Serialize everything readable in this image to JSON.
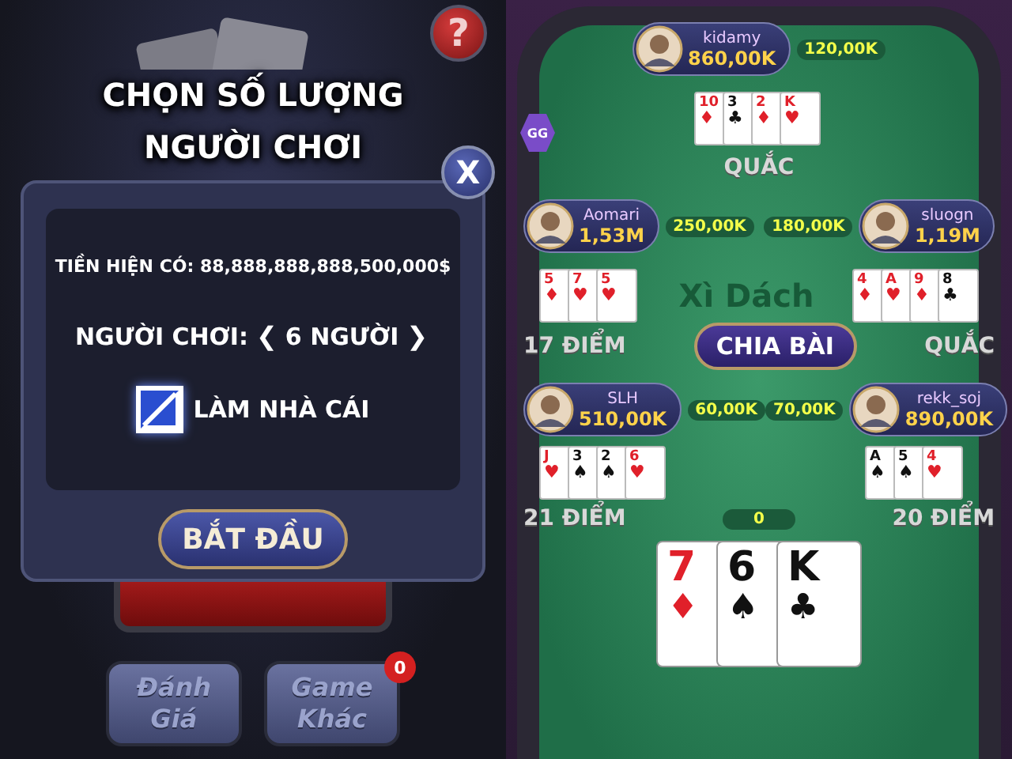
{
  "lobby": {
    "help_button": "?",
    "close_button": "X",
    "title": "CHỌN SỐ LƯỢNG NGƯỜI CHƠI",
    "balance": "TIỀN HIỆN CÓ: 88,888,888,888,500,000$",
    "players_label": "NGƯỜI CHƠI:",
    "prev_button": "❮",
    "players_value": "6 NGƯỜI",
    "next_button": "❯",
    "dealer_option": {
      "label": "LÀM NHÀ CÁI",
      "checked": true
    },
    "start_button": "BẮT ĐẦU",
    "menu_buttons": [
      {
        "label": "Đánh Giá"
      },
      {
        "label": "Game Khác",
        "badge": "0"
      }
    ]
  },
  "table": {
    "gg_badge": "GG",
    "watermark": "Xì Dách",
    "deal_button": "CHIA BÀI",
    "pot": "0",
    "seats": [
      {
        "name": "kidamy",
        "money": "860,00K",
        "bet": "120,00K",
        "result": "QUẮC",
        "cards": [
          {
            "rank": "10",
            "suit": "♦",
            "red": true
          },
          {
            "rank": "3",
            "suit": "♣",
            "red": false
          },
          {
            "rank": "2",
            "suit": "♦",
            "red": true
          },
          {
            "rank": "K",
            "suit": "♥",
            "red": true
          }
        ]
      },
      {
        "name": "Aomari",
        "money": "1,53M",
        "bet": "250,00K",
        "result": "17 ĐIỂM",
        "cards": [
          {
            "rank": "5",
            "suit": "♦",
            "red": true
          },
          {
            "rank": "7",
            "suit": "♥",
            "red": true
          },
          {
            "rank": "5",
            "suit": "♥",
            "red": true
          }
        ]
      },
      {
        "name": "sluogn",
        "money": "1,19M",
        "bet": "180,00K",
        "result": "QUẮC",
        "cards": [
          {
            "rank": "4",
            "suit": "♦",
            "red": true
          },
          {
            "rank": "A",
            "suit": "♥",
            "red": true
          },
          {
            "rank": "9",
            "suit": "♦",
            "red": true
          },
          {
            "rank": "8",
            "suit": "♣",
            "red": false
          }
        ]
      },
      {
        "name": "SLH",
        "money": "510,00K",
        "bet": "60,00K",
        "result": "21 ĐIỂM",
        "cards": [
          {
            "rank": "J",
            "suit": "♥",
            "red": true
          },
          {
            "rank": "3",
            "suit": "♠",
            "red": false
          },
          {
            "rank": "2",
            "suit": "♠",
            "red": false
          },
          {
            "rank": "6",
            "suit": "♥",
            "red": true
          }
        ]
      },
      {
        "name": "rekk_soj",
        "money": "890,00K",
        "bet": "70,00K",
        "result": "20 ĐIỂM",
        "cards": [
          {
            "rank": "A",
            "suit": "♠",
            "red": false
          },
          {
            "rank": "5",
            "suit": "♠",
            "red": false
          },
          {
            "rank": "4",
            "suit": "♥",
            "red": true
          }
        ]
      }
    ],
    "my_cards": [
      {
        "rank": "7",
        "suit": "♦",
        "red": true
      },
      {
        "rank": "6",
        "suit": "♠",
        "red": false
      },
      {
        "rank": "K",
        "suit": "♣",
        "red": false
      }
    ]
  }
}
